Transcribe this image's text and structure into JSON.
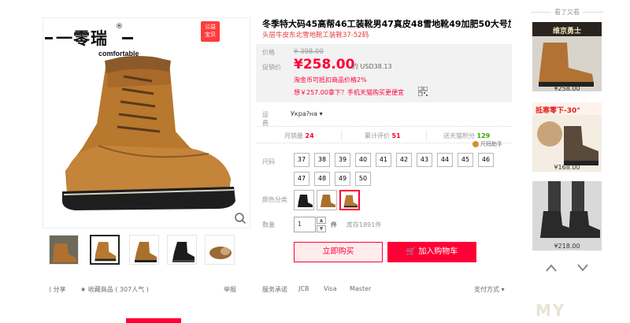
{
  "gallery": {
    "brand_name": "一零瑞",
    "brand_reg": "®",
    "brand_tagline": "comfortable",
    "badge_line1": "公益",
    "badge_line2": "宝贝"
  },
  "product": {
    "title": "冬季特大码45高帮46工装靴男47真皮48雪地靴49加肥50大号加绒棉鞋",
    "subtitle": "头层牛皮东北雪地靴工装靴37-52码"
  },
  "price": {
    "label_price": "价格",
    "original": "¥ 398.00",
    "label_promo": "促销价",
    "promo": "¥258.00",
    "usd": "约 USD38.13",
    "coin_note": "淘金币可抵扣商品价格2%",
    "mobile_note": "想￥257.00拿下？手机天猫购买更便宜"
  },
  "shipping": {
    "label": "运费",
    "destination": "Укра?на ▾"
  },
  "stats": {
    "monthly_sales_label": "月销量",
    "monthly_sales": "24",
    "reviews_label": "累计评价",
    "reviews": "51",
    "points_label": "送天猫积分",
    "points": "129",
    "helper": "尺码助手"
  },
  "sizes": {
    "label": "尺码",
    "options": [
      "37",
      "38",
      "39",
      "40",
      "41",
      "42",
      "43",
      "44",
      "45",
      "46",
      "47",
      "48",
      "49",
      "50"
    ]
  },
  "colors": {
    "label": "颜色分类"
  },
  "quantity": {
    "label": "数量",
    "value": "1",
    "unit": "件",
    "stock": "库存1891件"
  },
  "actions": {
    "buy": "立即购买",
    "cart": "加入购物车"
  },
  "share": {
    "share": "分享",
    "favorite": "收藏商品",
    "popularity": "( 307人气 )",
    "report": "举报"
  },
  "payment": {
    "label": "服务承诺",
    "jcb": "JCB",
    "visa": "Visa",
    "master": "Master",
    "methods": "支付方式 ▾"
  },
  "seen": {
    "title": "看了又看",
    "items": [
      {
        "price": "¥258.00",
        "caption": "维京勇士"
      },
      {
        "price": "¥168.00",
        "caption": "抵寒零下-30°"
      },
      {
        "price": "¥218.00",
        "caption": ""
      }
    ]
  },
  "colors_theme": {
    "accent": "#ff0036",
    "leather": "#b8782e",
    "dark": "#222222"
  }
}
